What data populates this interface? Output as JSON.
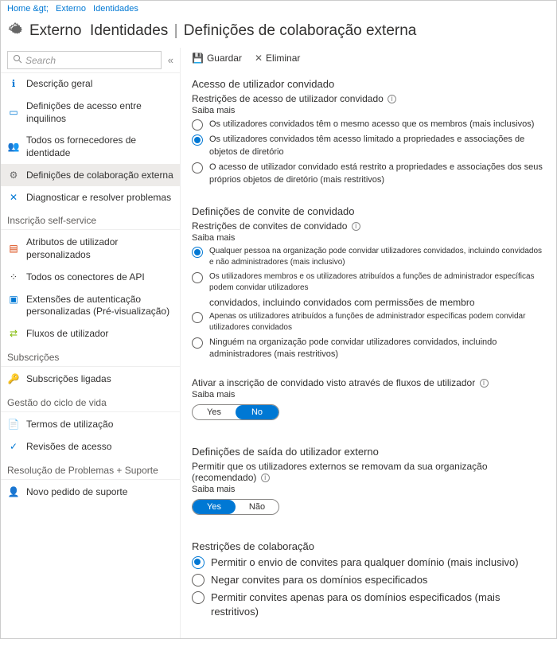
{
  "breadcrumb": {
    "home": "Home &gt;",
    "ext": "Externo",
    "ids": "Identidades"
  },
  "title": {
    "p1": "Externo",
    "p2": "Identidades",
    "sep": "|",
    "p3": "Definições de colaboração externa"
  },
  "search": {
    "placeholder": "Search"
  },
  "nav": {
    "items1": [
      {
        "label": "Descrição geral"
      },
      {
        "label": "Definições de acesso entre inquilinos"
      },
      {
        "label": "Todos os fornecedores de identidade"
      },
      {
        "label": "Definições de colaboração externa"
      },
      {
        "label": "Diagnosticar e resolver problemas"
      }
    ],
    "sec1": "Inscrição self-service",
    "items2": [
      {
        "label": "Atributos de utilizador personalizados"
      },
      {
        "label": "Todos os conectores de API"
      },
      {
        "label": "Extensões de autenticação personalizadas (Pré-visualização)"
      },
      {
        "label": "Fluxos de utilizador"
      }
    ],
    "sec2": "Subscrições",
    "items3": [
      {
        "label": "Subscrições ligadas"
      }
    ],
    "sec3": "Gestão do ciclo de vida",
    "items4": [
      {
        "label": "Termos de utilização"
      },
      {
        "label": "Revisões de acesso"
      }
    ],
    "sec4": "Resolução de Problemas + Suporte",
    "items5": [
      {
        "label": "Novo pedido de suporte"
      }
    ]
  },
  "toolbar": {
    "save": "Guardar",
    "discard": "Eliminar"
  },
  "s1": {
    "h": "Acesso de utilizador convidado",
    "sub": "Restrições de acesso de utilizador convidado",
    "learn": "Saiba mais",
    "r1": "Os utilizadores convidados têm o mesmo acesso que os membros (mais inclusivos)",
    "r2": "Os utilizadores convidados têm acesso limitado a propriedades e associações de objetos de diretório",
    "r3": "O acesso de utilizador convidado está restrito a propriedades e associações dos seus próprios objetos de diretório (mais restritivos)"
  },
  "s2": {
    "h": "Definições de convite de convidado",
    "sub": "Restrições de convites de convidado",
    "learn": "Saiba mais",
    "r1": "Qualquer pessoa na organização pode convidar utilizadores convidados, incluindo convidados e não administradores (mais inclusivo)",
    "r2a": "Os utilizadores membros e os utilizadores atribuídos a funções de administrador específicas podem convidar utilizadores",
    "r2b": "convidados, incluindo convidados com permissões de membro",
    "r3": "Apenas os utilizadores atribuídos a funções de administrador específicas podem convidar utilizadores convidados",
    "r4": "Ninguém na organização pode convidar utilizadores convidados, incluindo administradores (mais restritivos)"
  },
  "s3": {
    "h": "Ativar a inscrição de convidado visto através de fluxos de utilizador",
    "learn": "Saiba mais",
    "yes": "Yes",
    "no": "No"
  },
  "s4": {
    "h": "Definições de saída do utilizador externo",
    "sub": "Permitir que os utilizadores externos se removam da sua organização (recomendado)",
    "learn": "Saiba mais",
    "yes": "Yes",
    "no": "Não"
  },
  "s5": {
    "h": "Restrições de colaboração",
    "r1": "Permitir o envio de convites para qualquer domínio (mais inclusivo)",
    "r2": "Negar convites para os domínios especificados",
    "r3": "Permitir convites apenas para os domínios especificados (mais restritivos)"
  }
}
